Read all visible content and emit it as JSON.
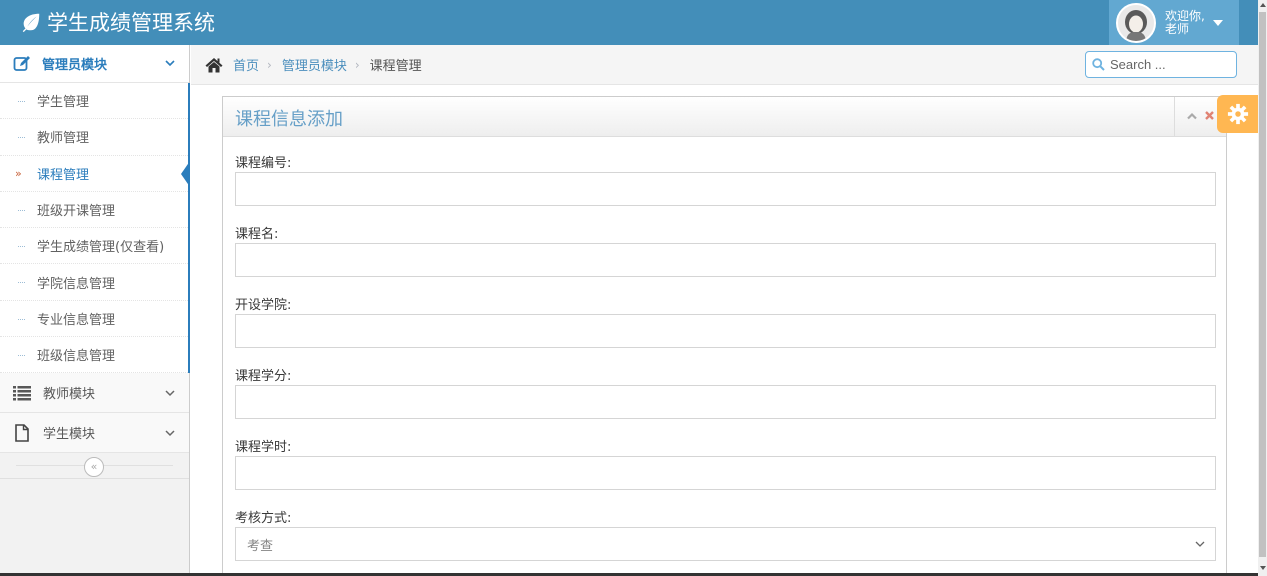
{
  "app": {
    "title": "学生成绩管理系统",
    "welcome_line1": "欢迎你,",
    "welcome_line2": "老师"
  },
  "sidebar": {
    "admin_module": "管理员模块",
    "items": [
      {
        "label": "学生管理"
      },
      {
        "label": "教师管理"
      },
      {
        "label": "课程管理"
      },
      {
        "label": "班级开课管理"
      },
      {
        "label": "学生成绩管理(仅查看)"
      },
      {
        "label": "学院信息管理"
      },
      {
        "label": "专业信息管理"
      },
      {
        "label": "班级信息管理"
      }
    ],
    "teacher_module": "教师模块",
    "student_module": "学生模块",
    "collapse_glyph": "«"
  },
  "breadcrumb": {
    "home": "首页",
    "module": "管理员模块",
    "current": "课程管理",
    "sep": "›"
  },
  "search": {
    "placeholder": "Search ..."
  },
  "form": {
    "title": "课程信息添加",
    "fields": [
      {
        "label": "课程编号:",
        "value": ""
      },
      {
        "label": "课程名:",
        "value": ""
      },
      {
        "label": "开设学院:",
        "value": ""
      },
      {
        "label": "课程学分:",
        "value": ""
      },
      {
        "label": "课程学时:",
        "value": ""
      }
    ],
    "assess_label": "考核方式:",
    "assess_value": "考查"
  },
  "colors": {
    "navbar": "#438eb9",
    "accent": "#2b7dbc",
    "settings": "#ffb752",
    "title": "#669fc7"
  }
}
